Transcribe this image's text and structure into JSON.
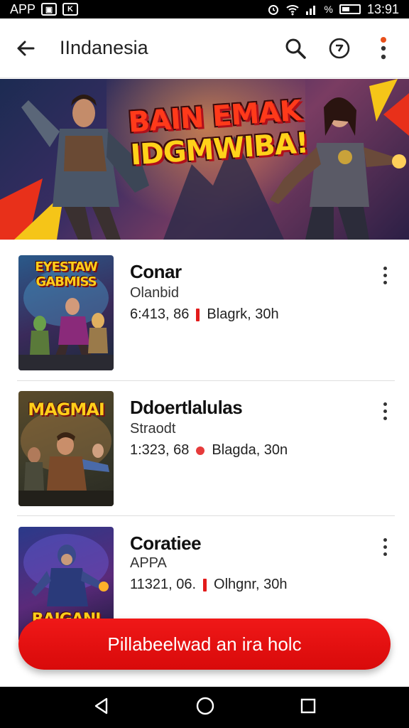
{
  "status_bar": {
    "carrier": "APP",
    "signal_percent": "%",
    "time": "13:91"
  },
  "app_bar": {
    "title": "IIndanesia",
    "icons": [
      "back-arrow-icon",
      "search-icon",
      "history-icon",
      "more-vert-icon"
    ]
  },
  "banner": {
    "title_line1": "BAIN EMAK",
    "title_line2": "IDGMWIBA!"
  },
  "games": [
    {
      "thumb_label": "EYESTAW GABMISS",
      "name": "Conar",
      "subtitle": "Olanbid",
      "stats": "6:413, 86",
      "badge": "Blagrk, 30h",
      "marker": "bar"
    },
    {
      "thumb_label": "MAGMAI",
      "name": "Ddoertlalulas",
      "subtitle": "Straodt",
      "stats": "1:323, 68",
      "badge": "Blagda, 30n",
      "marker": "dot"
    },
    {
      "thumb_label": "BAIGANI",
      "name": "Coratiee",
      "subtitle": "APPA",
      "stats": "11321, 06.",
      "badge": "Olhgnr, 30h",
      "marker": "bar"
    }
  ],
  "cta": {
    "label": "Pillabeelwad an ira holc"
  },
  "nav_bar": {
    "icons": [
      "back-triangle-icon",
      "home-circle-icon",
      "recents-square-icon"
    ]
  },
  "colors": {
    "accent": "#e21b1b",
    "status_bar": "#000000",
    "banner_text": "#ffd21a"
  }
}
